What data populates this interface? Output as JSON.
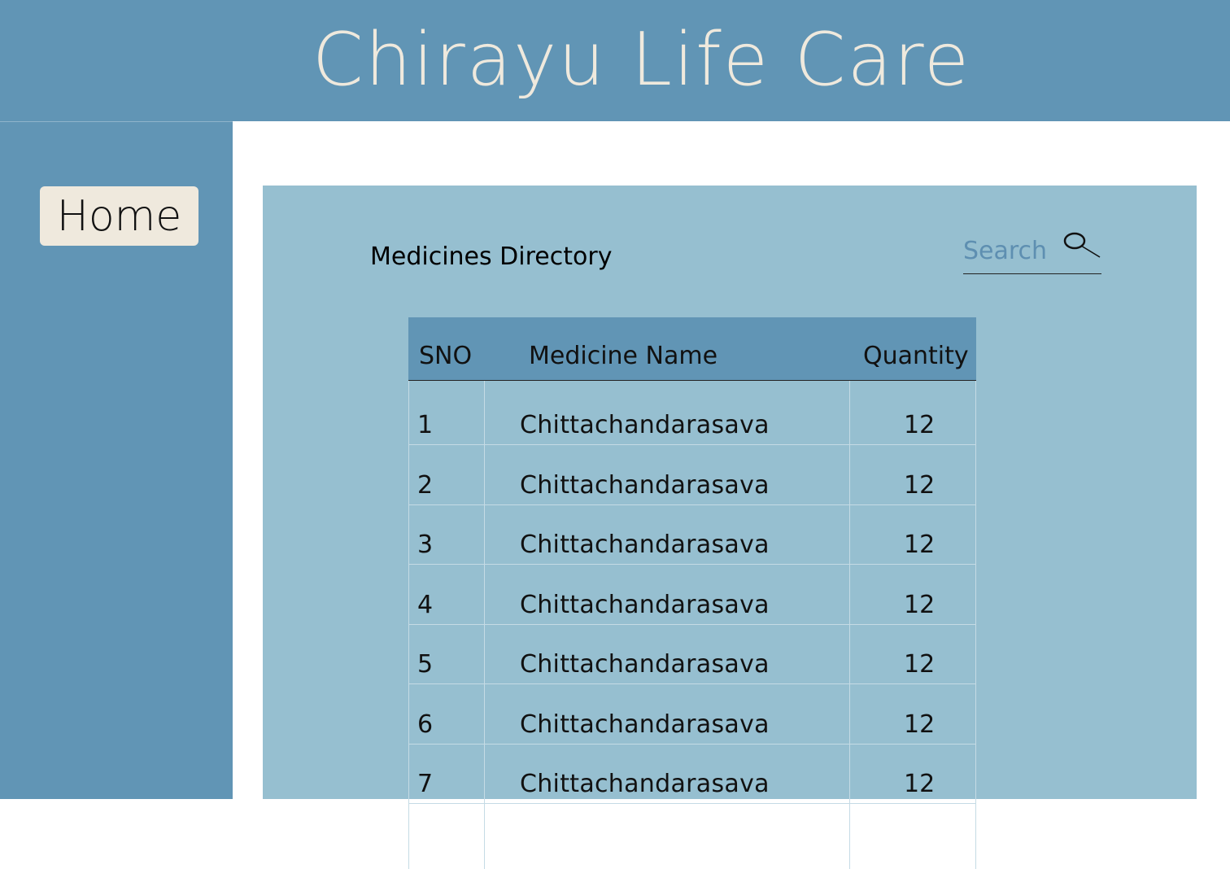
{
  "header": {
    "title": "Chirayu Life Care"
  },
  "sidebar": {
    "home_label": "Home"
  },
  "main": {
    "title": "Medicines Directory",
    "search": {
      "placeholder": "Search",
      "icon": "search-icon"
    },
    "table": {
      "columns": [
        "SNO",
        "Medicine Name",
        "Quantity"
      ],
      "rows": [
        {
          "sno": "1",
          "name": "Chittachandarasava",
          "quantity": "12"
        },
        {
          "sno": "2",
          "name": "Chittachandarasava",
          "quantity": "12"
        },
        {
          "sno": "3",
          "name": "Chittachandarasava",
          "quantity": "12"
        },
        {
          "sno": "4",
          "name": "Chittachandarasava",
          "quantity": "12"
        },
        {
          "sno": "5",
          "name": "Chittachandarasava",
          "quantity": "12"
        },
        {
          "sno": "6",
          "name": "Chittachandarasava",
          "quantity": "12"
        },
        {
          "sno": "7",
          "name": "Chittachandarasava",
          "quantity": "12"
        }
      ]
    }
  },
  "colors": {
    "header_bg": "#6195b5",
    "sidebar_bg": "#6195b5",
    "panel_bg": "#96bfd0",
    "title_text": "#efe9dd",
    "button_bg": "#efe9dd",
    "search_text": "#5e8fb1"
  }
}
